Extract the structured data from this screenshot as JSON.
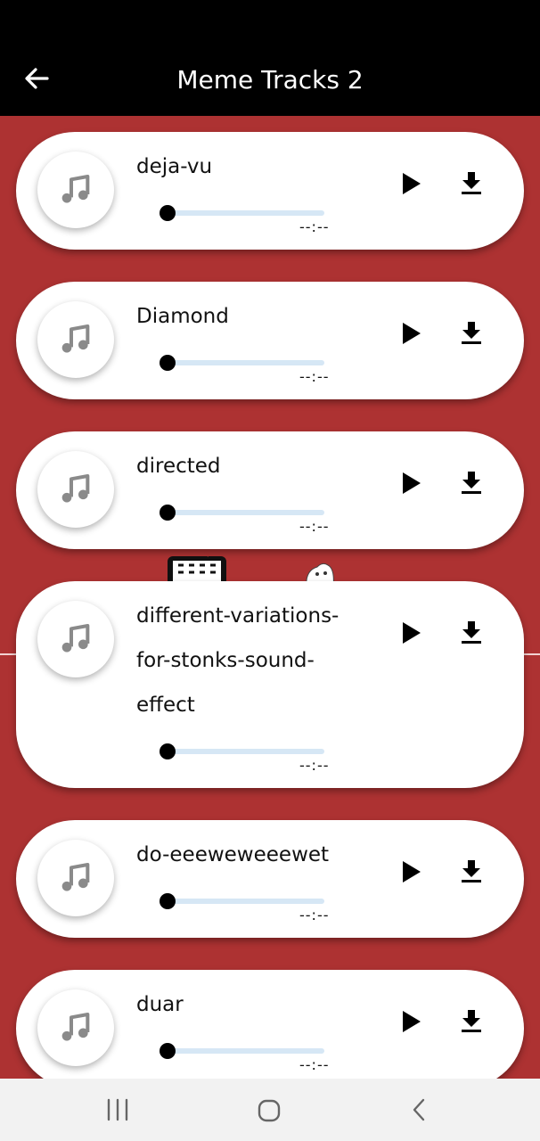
{
  "appbar": {
    "title": "Meme Tracks 2",
    "back_icon": "arrow-left-icon"
  },
  "colors": {
    "background": "#ad3232",
    "appbar": "#000000",
    "card": "#ffffff",
    "slider_track": "#d6e7f5",
    "slider_thumb": "#000000"
  },
  "tracks": [
    {
      "title": "deja-vu",
      "time": "--:--",
      "progress": 0
    },
    {
      "title": "Diamond",
      "time": "--:--",
      "progress": 0
    },
    {
      "title": "directed",
      "time": "--:--",
      "progress": 0
    },
    {
      "title": "different-variations-for-stonks-sound-effect",
      "time": "--:--",
      "progress": 0
    },
    {
      "title": "do-eeeweweeewet",
      "time": "--:--",
      "progress": 0
    },
    {
      "title": "duar",
      "time": "--:--",
      "progress": 0
    }
  ],
  "track_icons": {
    "artwork": "music-note-icon",
    "play": "play-icon",
    "download": "download-icon"
  },
  "navbar": {
    "recent_icon": "recent-apps-icon",
    "home_icon": "home-icon",
    "back_icon": "chevron-left-icon"
  }
}
